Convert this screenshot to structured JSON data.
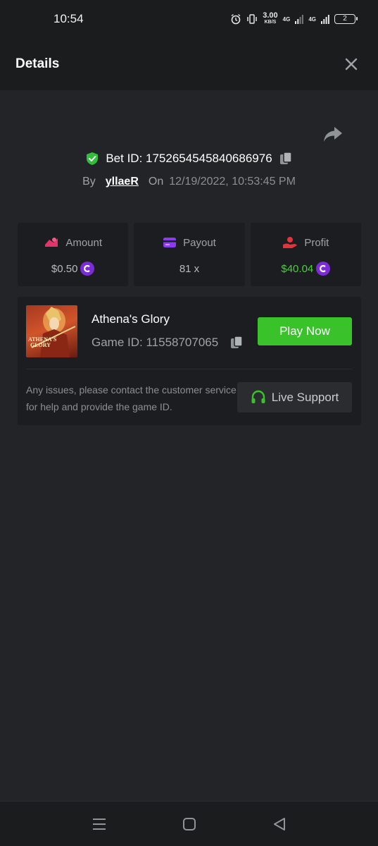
{
  "status_bar": {
    "time": "10:54",
    "speed_value": "3.00",
    "speed_unit": "KB/S",
    "net1": "4G",
    "net2": "4G",
    "battery": "2"
  },
  "header": {
    "title": "Details"
  },
  "bet": {
    "id_text": "Bet ID: 1752654545840686976",
    "by_label": "By",
    "user": "yllaeR",
    "on_label": "On",
    "datetime": "12/19/2022, 10:53:45 PM"
  },
  "stats": [
    {
      "label": "Amount",
      "value": "$0.50",
      "has_coin": true,
      "icon": "amount-icon",
      "icon_color": "#e0356b"
    },
    {
      "label": "Payout",
      "value": "81 x",
      "has_coin": false,
      "icon": "card-icon",
      "icon_color": "#8a3df0"
    },
    {
      "label": "Profit",
      "value": "$40.04",
      "has_coin": true,
      "icon": "profit-icon",
      "icon_color": "#e0353a"
    }
  ],
  "game": {
    "name": "Athena's Glory",
    "id_text": "Game ID: 11558707065",
    "thumb_text_1": "ATHENA'S",
    "thumb_text_2": "GLORY",
    "play_label": "Play Now",
    "support_text": "Any issues, please contact the customer service for help and provide the game ID.",
    "support_label": "Live Support"
  },
  "colors": {
    "accent_green": "#39c22a",
    "profit_green": "#49d13b",
    "coin_purple": "#7c2bd9",
    "background": "#232427"
  }
}
